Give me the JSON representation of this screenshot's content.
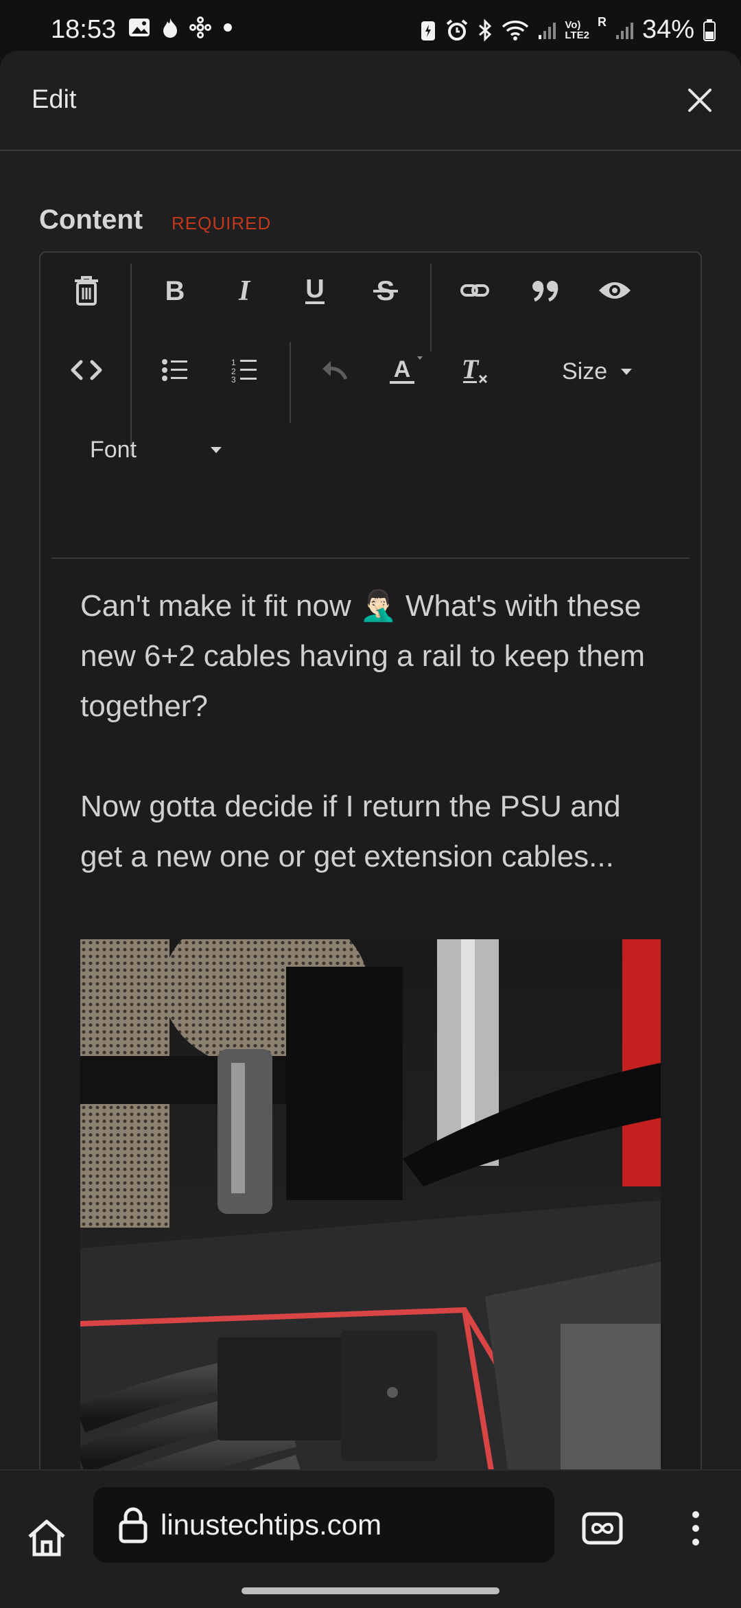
{
  "status_bar": {
    "time": "18:53",
    "battery": "34%",
    "network_label_top": "Vo)",
    "network_label_bottom": "LTE2",
    "roaming": "R"
  },
  "modal": {
    "title": "Edit",
    "close_icon": "close-icon"
  },
  "field": {
    "label": "Content",
    "required": "REQUIRED"
  },
  "toolbar": {
    "row1": [
      "trash-icon",
      "bold-icon",
      "italic-icon",
      "underline-icon",
      "strikethrough-icon",
      "link-icon",
      "quote-icon",
      "preview-eye-icon"
    ],
    "row2": [
      "code-icon",
      "bullet-list-icon",
      "numbered-list-icon",
      "undo-icon",
      "text-color-icon",
      "clear-format-icon"
    ],
    "size_label": "Size",
    "font_label": "Font"
  },
  "post": {
    "line1": "Can't make it fit now 🤦🏻‍♂️ What's with these new 6+2 cables having a rail to keep them together?",
    "line2": "Now gotta decide if I return the PSU and get a new one or get extension cables..."
  },
  "browser": {
    "url": "linustechtips.com",
    "home_icon": "home-icon",
    "lock_icon": "lock-icon",
    "tabs_icon": "tabs-infinity-icon",
    "menu_icon": "kebab-menu-icon"
  },
  "colors": {
    "background": "#1f1f21",
    "required": "#c0391b",
    "text": "#d0d0d0"
  }
}
